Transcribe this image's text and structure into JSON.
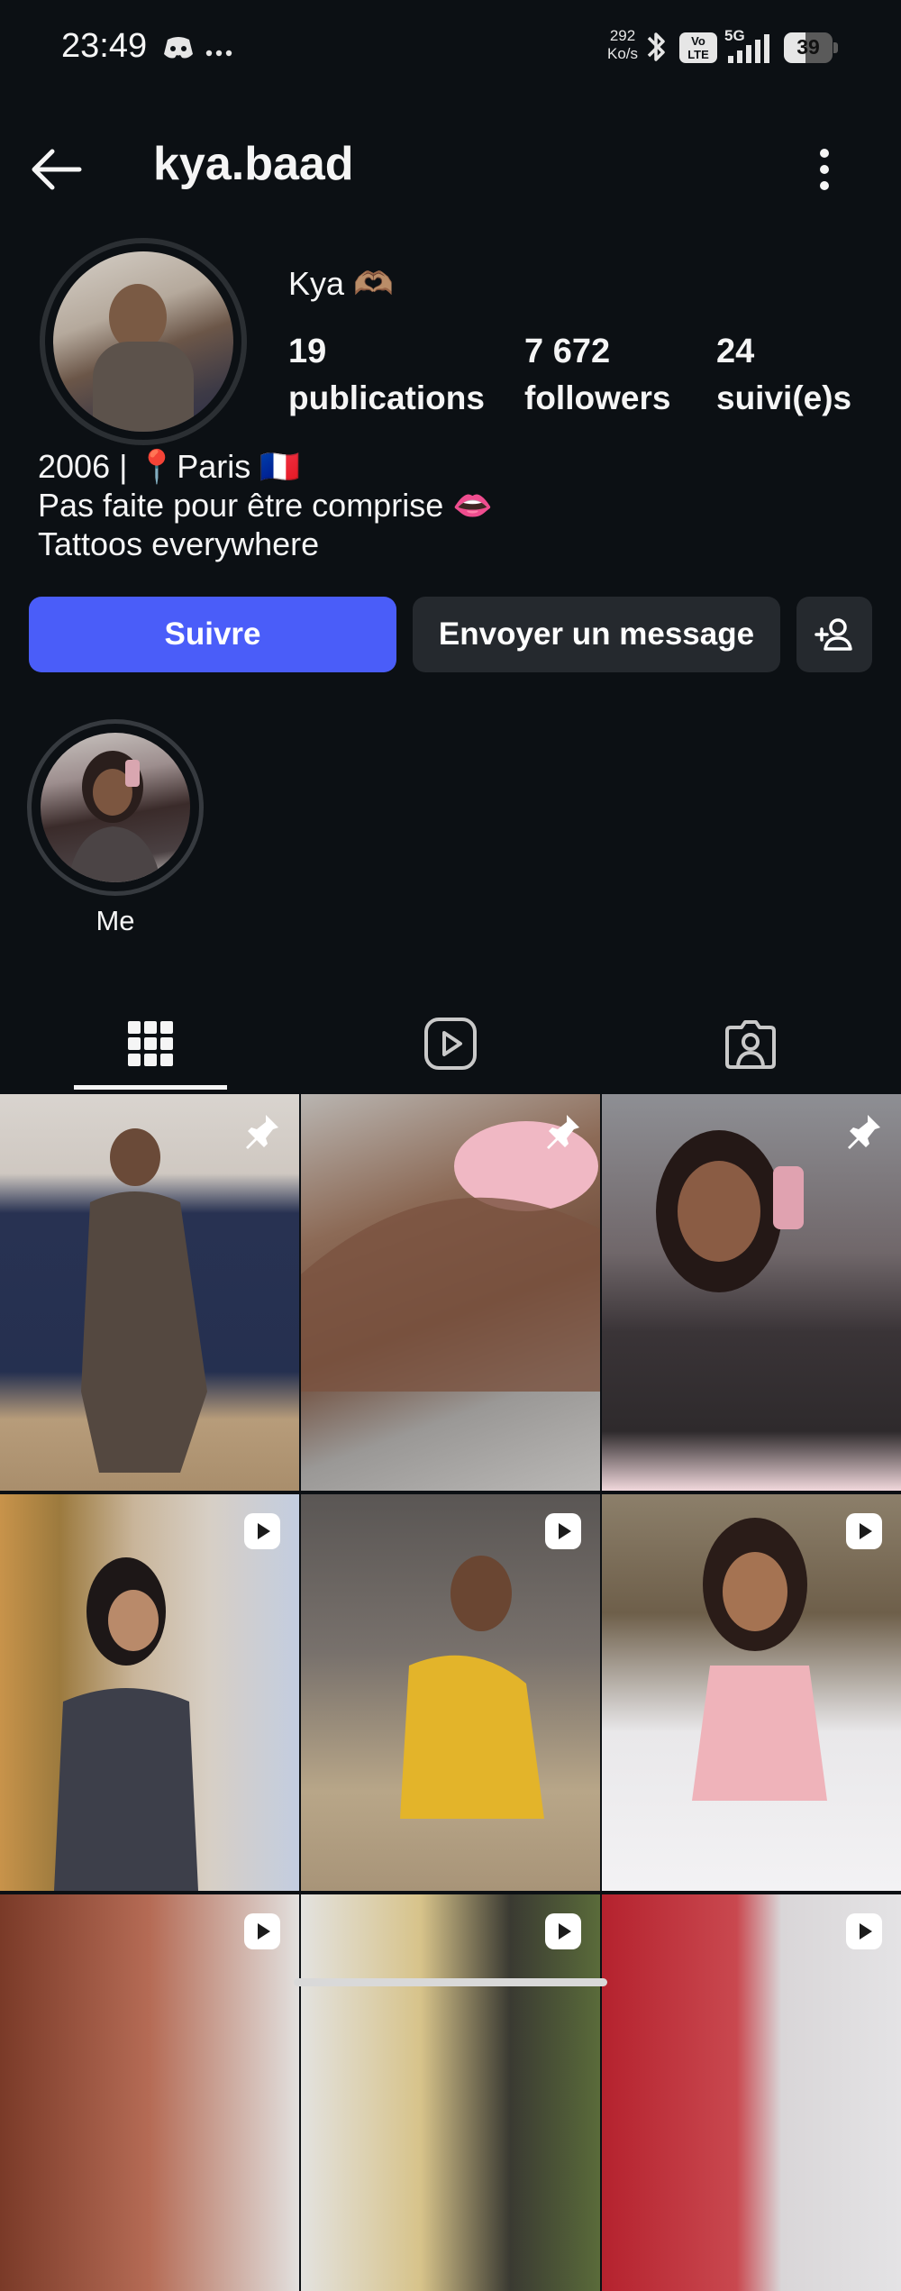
{
  "status_bar": {
    "time": "23:49",
    "net_speed_value": "292",
    "net_speed_unit": "Ko/s",
    "volte": "Vo LTE",
    "network": "5G",
    "battery": "39",
    "icons": [
      "discord-icon",
      "more-dots-icon",
      "bluetooth-icon",
      "signal-icon",
      "battery-icon"
    ]
  },
  "header": {
    "username": "kya.baad",
    "icons": [
      "back-arrow-icon",
      "kebab-menu-icon"
    ]
  },
  "profile": {
    "display_name": "Kya 🫶🏽",
    "stats": [
      {
        "value": "19",
        "label": "publications"
      },
      {
        "value": "7 672",
        "label": "followers"
      },
      {
        "value": "24",
        "label": "suivi(e)s"
      }
    ],
    "bio": [
      "2006 | 📍Paris 🇫🇷",
      "Pas faite pour être comprise 👄",
      "Tattoos everywhere"
    ]
  },
  "actions": {
    "follow_label": "Suivre",
    "message_label": "Envoyer un message",
    "follow_color": "#4a5df9",
    "secondary_color": "#25292e"
  },
  "highlights": [
    {
      "label": "Me"
    }
  ],
  "tabs": [
    {
      "name": "grid-tab",
      "icon": "grid-icon",
      "active": true
    },
    {
      "name": "reels-tab",
      "icon": "reels-play-icon",
      "active": false
    },
    {
      "name": "tagged-tab",
      "icon": "tagged-person-icon",
      "active": false
    }
  ],
  "posts": [
    {
      "badge": "pin-icon"
    },
    {
      "badge": "pin-icon"
    },
    {
      "badge": "pin-icon"
    },
    {
      "badge": "reel-icon"
    },
    {
      "badge": "reel-icon"
    },
    {
      "badge": "reel-icon"
    },
    {
      "badge": "reel-icon"
    },
    {
      "badge": "reel-icon"
    },
    {
      "badge": "reel-icon"
    }
  ],
  "colors": {
    "background": "#0c1014",
    "text": "#f5f5f5"
  }
}
